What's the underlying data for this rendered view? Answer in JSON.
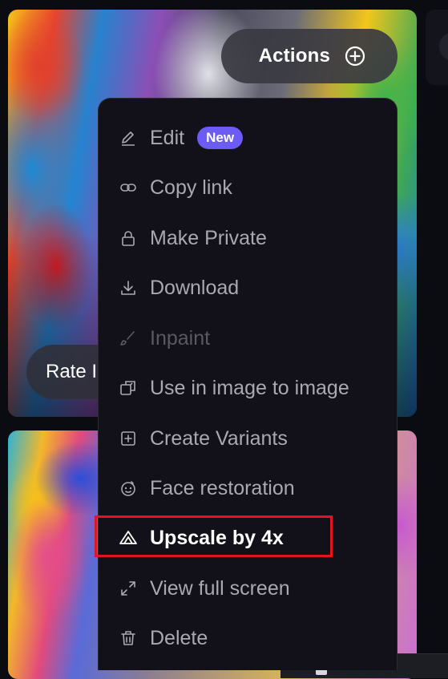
{
  "actions_button": {
    "label": "Actions",
    "icon": "plus-circle-icon"
  },
  "rate_pill": {
    "label": "Rate I"
  },
  "menu": {
    "items": [
      {
        "label": "Edit",
        "icon": "pencil-icon",
        "badge": "New"
      },
      {
        "label": "Copy link",
        "icon": "link-icon"
      },
      {
        "label": "Make Private",
        "icon": "lock-icon"
      },
      {
        "label": "Download",
        "icon": "download-icon"
      },
      {
        "label": "Inpaint",
        "icon": "brush-icon",
        "disabled": true
      },
      {
        "label": "Use in image to image",
        "icon": "image-to-image-icon"
      },
      {
        "label": "Create Variants",
        "icon": "plus-square-icon"
      },
      {
        "label": "Face restoration",
        "icon": "face-icon"
      },
      {
        "label": "Upscale by 4x",
        "icon": "upscale-icon",
        "highlighted": true
      },
      {
        "label": "View full screen",
        "icon": "expand-icon"
      },
      {
        "label": "Delete",
        "icon": "trash-icon"
      }
    ]
  },
  "colors": {
    "menu_background": "#121119",
    "badge": "#6c5cf5",
    "highlight_border": "#e0151f"
  }
}
